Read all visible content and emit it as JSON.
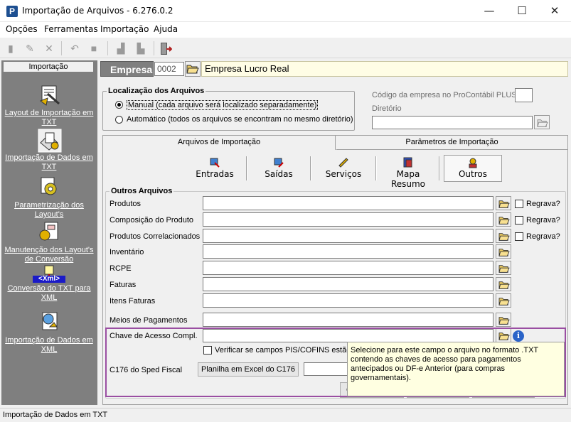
{
  "window": {
    "title": "Importação de Arquivos - 6.276.0.2",
    "app_icon_letter": "P",
    "minimize": "—",
    "maximize": "☐",
    "close": "✕"
  },
  "menu": [
    "Opções",
    "Ferramentas",
    "Importação",
    "Ajuda"
  ],
  "sidebar": {
    "header": "Importação",
    "items": [
      {
        "label": "Layout de Importação em TXT",
        "icon": "layout-txt-icon"
      },
      {
        "label": "Importação de Dados em TXT",
        "icon": "import-txt-icon"
      },
      {
        "label": "Parametrização dos Layout's",
        "icon": "gear-icon"
      },
      {
        "label": "Manutenção dos Layout's de Conversão",
        "icon": "maintenance-icon"
      },
      {
        "label": "Conversão do TXT para XML",
        "icon": "xml-convert-icon",
        "badge": "<Xml>"
      },
      {
        "label": "Importação de Dados em XML",
        "icon": "import-xml-icon"
      }
    ]
  },
  "empresa": {
    "label": "Empresa",
    "code": "0002",
    "name": "Empresa Lucro Real"
  },
  "localizacao": {
    "title": "Localização dos Arquivos",
    "options": [
      {
        "label": "Manual (cada arquivo será localizado separadamente)",
        "selected": true
      },
      {
        "label": "Automático (todos os arquivos se encontram no mesmo diretório)",
        "selected": false
      }
    ]
  },
  "procontabil": {
    "codigo_label": "Código da empresa no ProContábil PLUS",
    "diretorio_label": "Diretório"
  },
  "tabs": [
    "Arquivos de Importação",
    "Parâmetros de Importação"
  ],
  "subtabs": [
    {
      "label": "Entradas",
      "icon": "entradas-icon"
    },
    {
      "label": "Saídas",
      "icon": "saidas-icon"
    },
    {
      "label": "Serviços",
      "icon": "servicos-icon"
    },
    {
      "label": "Mapa Resumo",
      "icon": "mapa-resumo-icon"
    },
    {
      "label": "Outros",
      "icon": "outros-icon",
      "active": true
    }
  ],
  "outros": {
    "title": "Outros Arquivos",
    "rows": [
      {
        "label": "Produtos",
        "regrava": "Regrava?"
      },
      {
        "label": "Composição do Produto",
        "regrava": "Regrava?"
      },
      {
        "label": "Produtos Correlacionados",
        "regrava": "Regrava?"
      },
      {
        "label": "Inventário"
      },
      {
        "label": "RCPE"
      },
      {
        "label": "Faturas"
      },
      {
        "label": "Itens Faturas"
      },
      {
        "label": "Meios de Pagamentos"
      }
    ],
    "chave_label": "Chave de Acesso Compl.",
    "verificar_label": "Verificar se campos PIS/COFINS estão i",
    "c176_label": "C176 do Sped Fiscal",
    "c176_button": "Planilha em Excel do C176",
    "bottom_button_fragment": "C"
  },
  "tooltip": "Selecione para este campo o arquivo no formato .TXT contendo as chaves de acesso para pagamentos antecipados ou DF-e Anterior (para compras governamentais).",
  "status": "Importação de Dados em TXT",
  "colors": {
    "sidebar": "#7f7f7f",
    "highlight": "#9a4ea2",
    "tooltip_bg": "#ffffe1",
    "empresa_bg": "#fffde5"
  }
}
